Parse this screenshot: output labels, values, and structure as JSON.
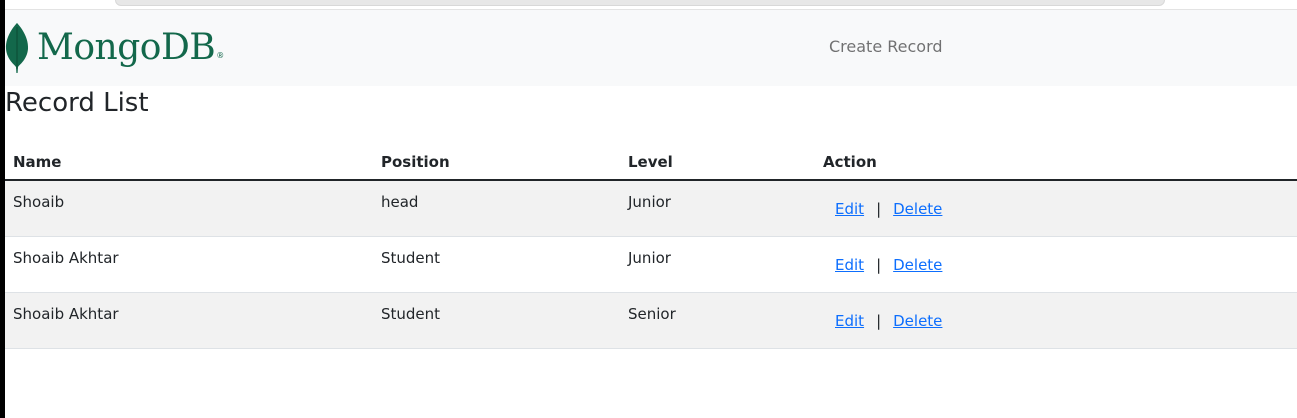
{
  "navbar": {
    "brand": {
      "text": "MongoDB",
      "reg_mark": "®",
      "leaf_color": "#13684b"
    },
    "create_link": "Create Record"
  },
  "page": {
    "title": "Record List"
  },
  "table": {
    "headers": {
      "name": "Name",
      "position": "Position",
      "level": "Level",
      "action": "Action"
    },
    "rows": [
      {
        "name": "Shoaib",
        "position": "head",
        "level": "Junior"
      },
      {
        "name": "Shoaib Akhtar",
        "position": "Student",
        "level": "Junior"
      },
      {
        "name": "Shoaib Akhtar",
        "position": "Student",
        "level": "Senior"
      }
    ],
    "actions": {
      "edit": "Edit",
      "separator": "|",
      "delete": "Delete"
    }
  },
  "colors": {
    "link": "#0d6efd",
    "navbar_bg": "#f8f9fa",
    "striped_row": "#f2f2f2"
  }
}
